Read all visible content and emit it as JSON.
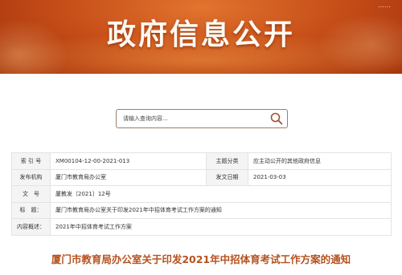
{
  "banner": {
    "title": "政府信息公开",
    "top_link": "……"
  },
  "search": {
    "placeholder": "请输入查询内容..."
  },
  "info": {
    "rows": [
      {
        "label1": "索 引 号",
        "value1": "XM00104-12-00-2021-013",
        "label2": "主题分类",
        "value2": "应主动公开的其他政府信息"
      },
      {
        "label1": "发布机构",
        "value1": "厦门市教育局办公室",
        "label2": "发文日期",
        "value2": "2021-03-03"
      },
      {
        "label1": "文　号",
        "value1": "厦教发〔2021〕12号"
      },
      {
        "label1": "标　题：",
        "value1": "厦门市教育局办公室关于印发2021年中招体育考试工作方案的通知"
      },
      {
        "label1": "内容概述：",
        "value1": "2021年中招体育考试工作方案"
      }
    ]
  },
  "document": {
    "title": "厦门市教育局办公室关于印发2021年中招体育考试工作方案的通知"
  },
  "colors": {
    "banner_primary": "#c8511a",
    "title_accent": "#b5521f",
    "label_bg": "#f4f4f4"
  },
  "icons": {
    "search": "search-icon"
  }
}
